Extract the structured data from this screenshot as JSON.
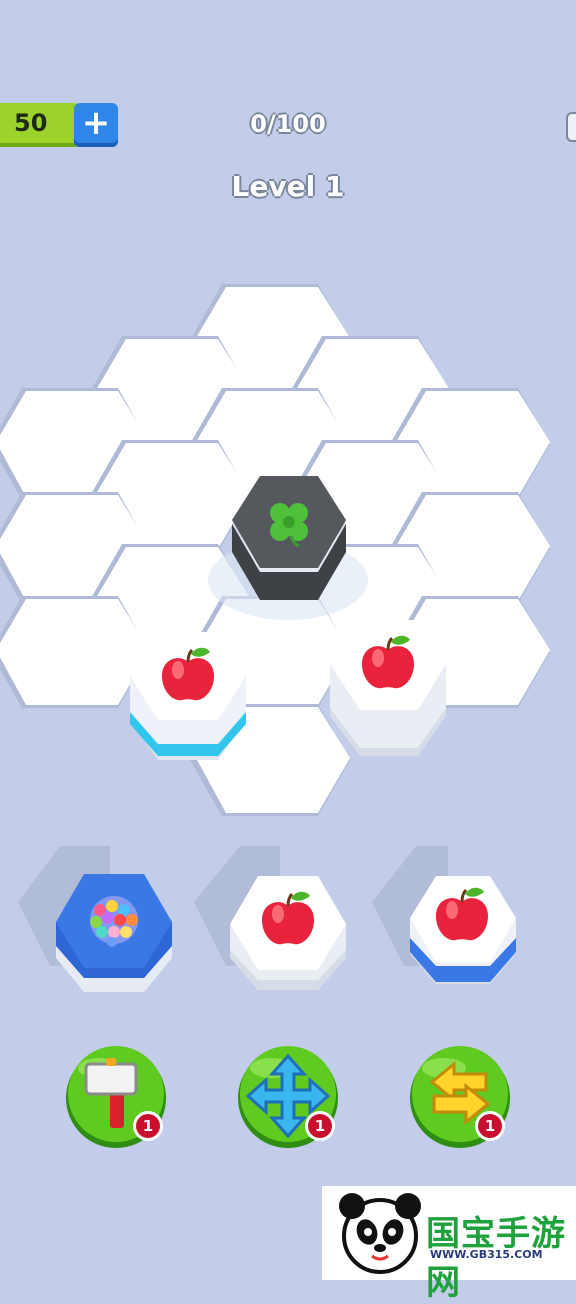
{
  "hud": {
    "coins": "50",
    "plus_label": "+",
    "progress": "0/100",
    "level": "Level 1"
  },
  "board": {
    "stacks": [
      {
        "item": "clover",
        "base_color": "#55585d"
      },
      {
        "item": "apple",
        "base_color": "#33c6ec"
      },
      {
        "item": "apple",
        "base_color": "#e8ecf4"
      }
    ]
  },
  "tray": [
    {
      "item": "candies",
      "base_color": "#3a78e6"
    },
    {
      "item": "apple",
      "base_color": "#e8ecf4"
    },
    {
      "item": "apple",
      "base_color": "#3a78e6"
    }
  ],
  "powerups": [
    {
      "icon": "hammer-icon",
      "count": "1"
    },
    {
      "icon": "move-arrows-icon",
      "count": "1"
    },
    {
      "icon": "swap-arrows-icon",
      "count": "1"
    }
  ],
  "watermark": {
    "title": "国宝手游网",
    "url": "WWW.GB315.COM"
  },
  "colors": {
    "background": "#c3cde9",
    "hex_face": "#ffffff",
    "badge": "#c8102e",
    "powerup_green": "#5fcb20"
  }
}
